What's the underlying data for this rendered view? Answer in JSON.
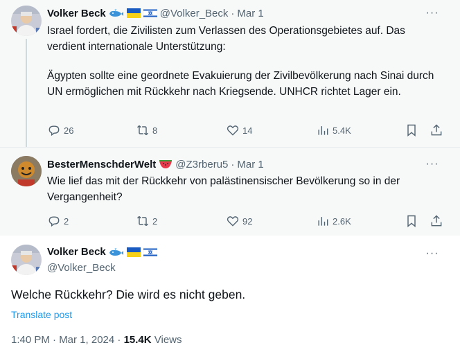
{
  "tweets": [
    {
      "name": "Volker Beck",
      "handle": "@Volker_Beck",
      "date": "Mar 1",
      "text": "Israel fordert, die Zivilisten zum Verlassen des Operationsgebietes auf. Das verdient internationale Unterstützung:",
      "text2": "Ägypten sollte eine geordnete Evakuierung der Zivilbevölkerung nach Sinai durch UN ermöglichen mit Rückkehr nach Kriegsende. UNHCR richtet Lager ein.",
      "replies": "26",
      "reposts": "8",
      "likes": "14",
      "views": "5.4K",
      "badges": [
        "whale-emoji",
        "ukraine-flag",
        "israel-flag"
      ]
    },
    {
      "name": "BesterMenschderWelt",
      "handle": "@Z3rberu5",
      "date": "Mar 1",
      "text": "Wie lief das mit der Rückkehr von palästinensischer Bevölkerung so in der Vergangenheit?",
      "replies": "2",
      "reposts": "2",
      "likes": "92",
      "views": "2.6K",
      "badges": [
        "watermelon-emoji"
      ]
    }
  ],
  "main": {
    "name": "Volker Beck",
    "handle": "@Volker_Beck",
    "text": "Welche Rückkehr? Die wird es nicht geben.",
    "translate": "Translate post",
    "time": "1:40 PM · Mar 1, 2024 · ",
    "views_count": "15.4K",
    "views_label": " Views",
    "badges": [
      "whale-emoji",
      "ukraine-flag",
      "israel-flag"
    ]
  },
  "separator": "·",
  "more_glyph": "···",
  "colors": {
    "accent": "#1d9bf0",
    "secondary_text": "#536471",
    "thread_line": "#cfd9de"
  }
}
